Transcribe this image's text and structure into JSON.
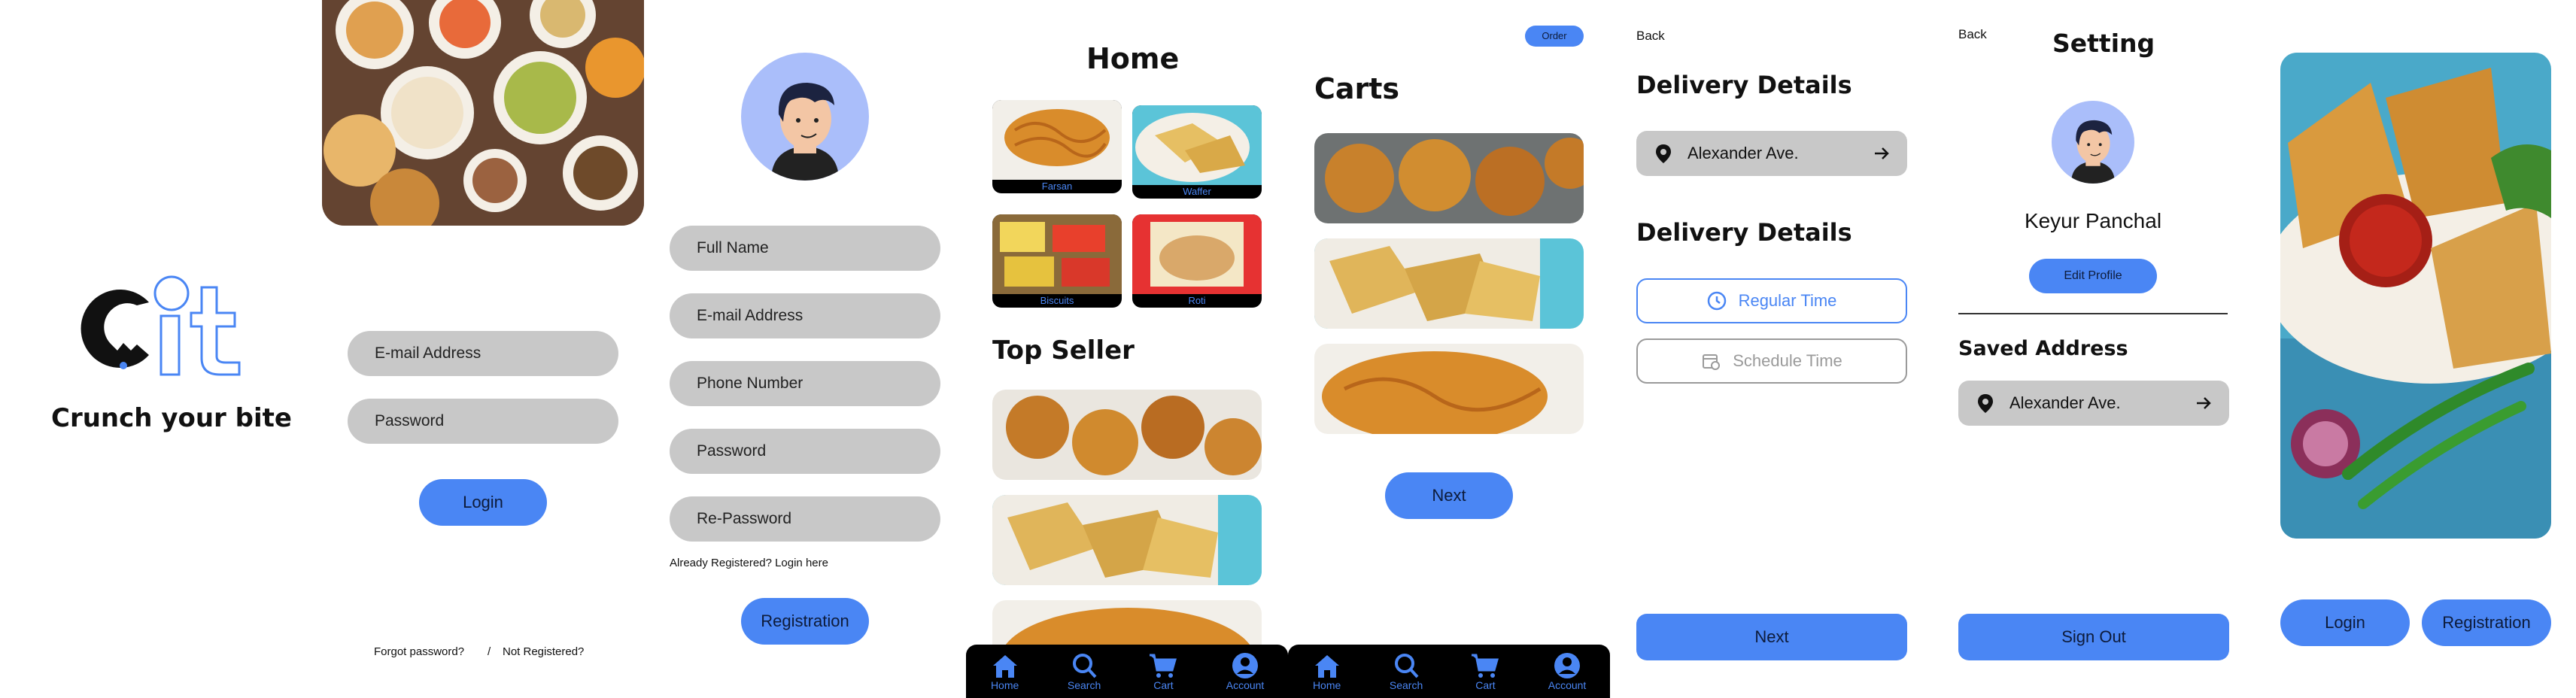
{
  "splash": {
    "logo_text": "Cit",
    "tagline": "Crunch your bite"
  },
  "login": {
    "email_placeholder": "E-mail Address",
    "password_placeholder": "Password",
    "login_label": "Login",
    "forgot_label": "Forgot password?",
    "separator": "/",
    "not_registered_label": "Not Registered?"
  },
  "register": {
    "fields": [
      "Full Name",
      "E-mail Address",
      "Phone Number",
      "Password",
      "Re-Password"
    ],
    "already_label": "Already Registered? Login here",
    "register_label": "Registration"
  },
  "home": {
    "title": "Home",
    "categories": [
      "Farsan",
      "Waffer",
      "Biscuits",
      "Roti"
    ],
    "top_seller_title": "Top Seller"
  },
  "nav": {
    "items": [
      "Home",
      "Search",
      "Cart",
      "Account"
    ]
  },
  "cart": {
    "order_label": "Order",
    "title": "Carts",
    "next_label": "Next"
  },
  "delivery": {
    "back_label": "Back",
    "details_title_1": "Delivery Details",
    "address": "Alexander Ave.",
    "details_title_2": "Delivery Details",
    "regular_time": "Regular Time",
    "schedule_time": "Schedule Time",
    "next_label": "Next"
  },
  "setting": {
    "back_label": "Back",
    "title": "Setting",
    "user_name": "Keyur Panchal",
    "edit_profile_label": "Edit Profile",
    "saved_address_title": "Saved Address",
    "address": "Alexander Ave.",
    "sign_out_label": "Sign Out"
  },
  "welcome": {
    "login_label": "Login",
    "register_label": "Registration"
  },
  "colors": {
    "accent": "#4a86f4",
    "field_bg": "#c8c8c8",
    "avatar_bg": "#aabefa"
  }
}
